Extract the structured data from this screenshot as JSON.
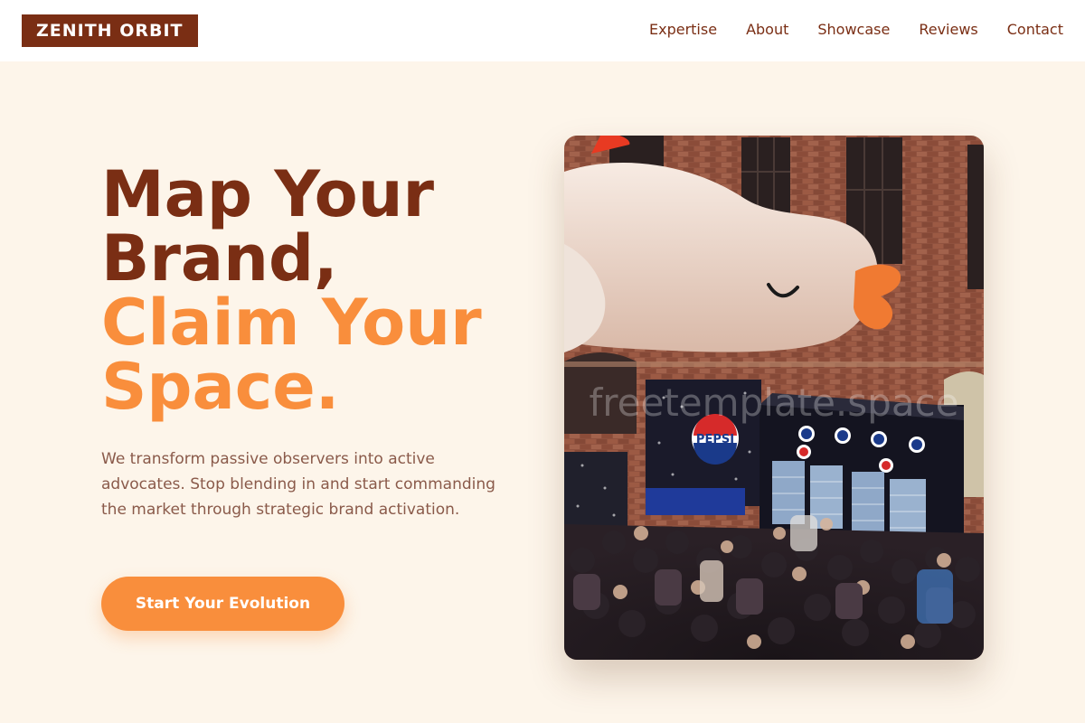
{
  "header": {
    "logo": "ZENITH ORBIT",
    "nav": [
      "Expertise",
      "About",
      "Showcase",
      "Reviews",
      "Contact"
    ]
  },
  "hero": {
    "title_line1": "Map Your",
    "title_line2": "Brand,",
    "title_line3": "Claim Your",
    "title_line4": "Space.",
    "description": "We transform passive observers into active advocates. Stop blending in and start commanding the market through strategic brand activation.",
    "cta_label": "Start Your Evolution"
  },
  "image": {
    "pepsi_logo_text": "PEPSI",
    "watermark": "freetemplate.space"
  },
  "colors": {
    "brand_dark": "#7a2e14",
    "accent": "#f98e3c",
    "background": "#fdf5ea"
  }
}
